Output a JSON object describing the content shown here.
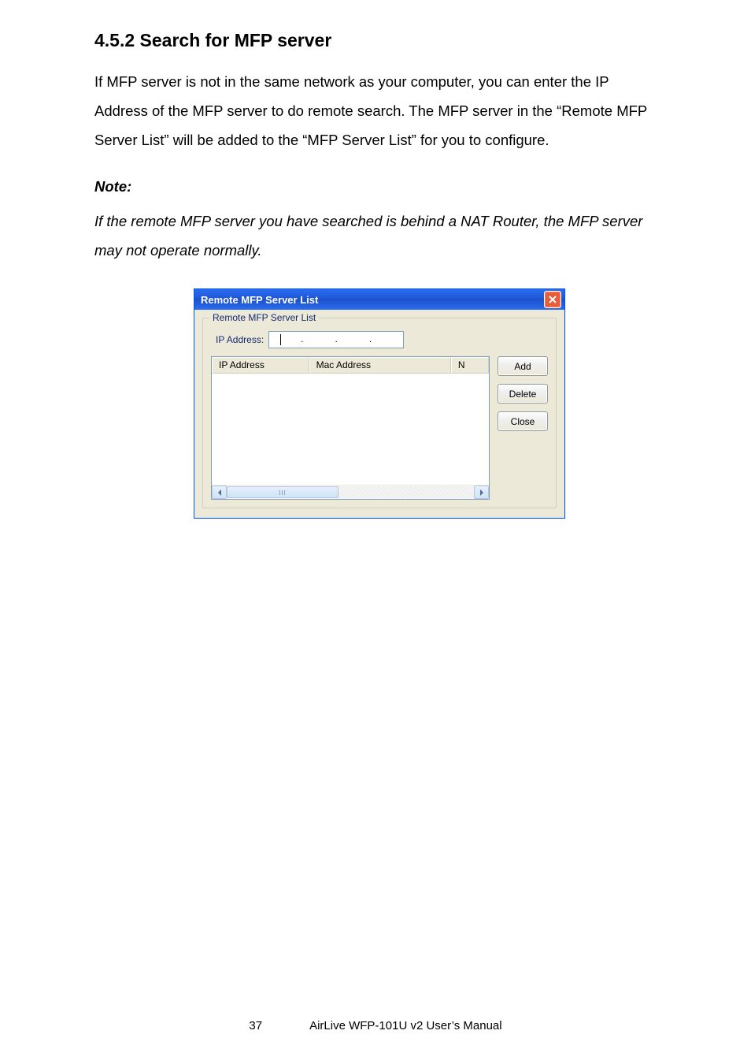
{
  "doc": {
    "heading": "4.5.2   Search for MFP server",
    "paragraph": "If MFP server is not in the same network as your computer, you can enter the IP Address of the MFP server to do remote search. The MFP server in the “Remote MFP Server List” will be added to the “MFP Server List” for you to configure.",
    "note_label": "Note:",
    "note_text": "If the remote MFP server you have searched is behind a NAT Router, the MFP server may not operate normally."
  },
  "dialog": {
    "title": "Remote MFP Server List",
    "groupbox_label": "Remote MFP Server List",
    "ip_label": "IP Address:",
    "columns": {
      "col1": "IP Address",
      "col2": "Mac Address",
      "col3": "N"
    },
    "buttons": {
      "add": "Add",
      "delete": "Delete",
      "close": "Close"
    }
  },
  "footer": {
    "page": "37",
    "manual": "AirLive WFP-101U v2 User’s Manual"
  }
}
